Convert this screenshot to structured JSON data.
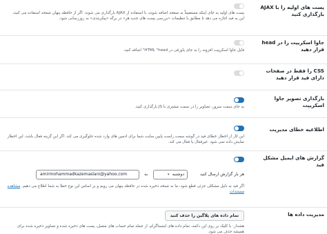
{
  "settings": {
    "ajax": {
      "title": "پست های اولیه را با AJAX بارگذاری کنید",
      "enabled": false,
      "description": "پست های اولیه به جای اینکه مستقیماً به صفحه اضافه شوند، با استفاده از AJAX بارگذاری می شوند. اگر از حافظه پنهان صفحه استفاده می کنید، این به فید اجازه می دهد تا مطابق با تنظیمات «بررسی پست های جدید هر» در برگه «پیکربندی» به روزرسانی شود."
    },
    "js_head": {
      "title": "جاوا اسکریپت را در head قرار دهید",
      "enabled": false,
      "description": "فایل جاوا اسکریپت افزونه را به جای پاورقی در HTML \"head\" اضافه کنید."
    },
    "css_feed_pages": {
      "title": "CSS را فقط در صفحات دارای فید قرار دهید",
      "enabled": false
    },
    "js_image_loading": {
      "title": "بارگذاری تصویر جاوا اسکریپت",
      "enabled": true,
      "description": "به جای سمت سرور، تصاویر را در سمت مشتری با JS بارگذاری کنید."
    },
    "admin_error": {
      "title": "اطلاعیه خطای مدیریت",
      "enabled": true,
      "description": "این کار از اخطار خطای فید در گوشه سمت راست پایین سایت شما برای ادمین های وارد شده جلوگیری می کند. اگر این گزینه فعال باشد، این اخطار نمایش داده نمی شود. غیرفعال یا فعال می کند."
    },
    "email_report": {
      "title": "گزارش های ایمیل مشکل فید",
      "enabled": true,
      "frequency_label": "هر بار گزارش ارسال کنید",
      "day_value": "دوشنبه",
      "to_label": "به",
      "email_value": "amirmohammadkazemaslani@yahoo.com",
      "description": "اگر فید به دلیل مشکلی جزئی قطع شود، ما به نسخه ذخیره شده در حافظه پنهان می رویم و بر اساس این نوع خطا به شما اطلاع می دهیم.",
      "link_text": "مشاهده مستندات"
    },
    "data_manager": {
      "title": "مدیریت داده ها",
      "button_label": "تمام داده های پلاگین را حذف کنید",
      "description": "هشدار: با کلیک بر روی این دکمه، تمام داده های اینستاگرام، از جمله تمام حساب های متصل، پست های ذخیره شده و تصاویر ذخیره شده برای همیشه حذف می شود."
    }
  }
}
